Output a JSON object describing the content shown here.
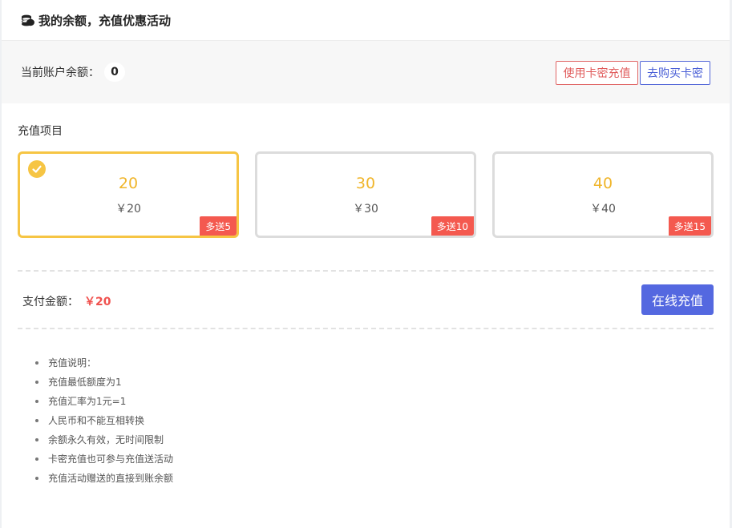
{
  "header": {
    "title": "我的余额，充值优惠活动"
  },
  "balance": {
    "label": "当前账户余额：",
    "value": "0",
    "use_card_button": "使用卡密充值",
    "buy_card_button": "去购买卡密"
  },
  "recharge": {
    "section_title": "充值项目",
    "tiers": [
      {
        "amount": "20",
        "price": "￥20",
        "bonus": "多送5",
        "selected": true
      },
      {
        "amount": "30",
        "price": "￥30",
        "bonus": "多送10",
        "selected": false
      },
      {
        "amount": "40",
        "price": "￥40",
        "bonus": "多送15",
        "selected": false
      }
    ]
  },
  "payment": {
    "label": "支付金额：",
    "value": "￥20",
    "pay_button": "在线充值"
  },
  "notes": [
    "充值说明：",
    "充值最低额度为1",
    "充值汇率为1元=1",
    "人民币和不能互相转换",
    "余额永久有效，无时间限制",
    "卡密充值也可参与充值送活动",
    "充值活动赠送的直接到账余额"
  ],
  "colors": {
    "accent_yellow": "#f6c544",
    "amount_yellow": "#f0b52a",
    "bonus_red": "#f4594f",
    "primary_blue": "#5468e0",
    "danger_red": "#e05a5a"
  }
}
